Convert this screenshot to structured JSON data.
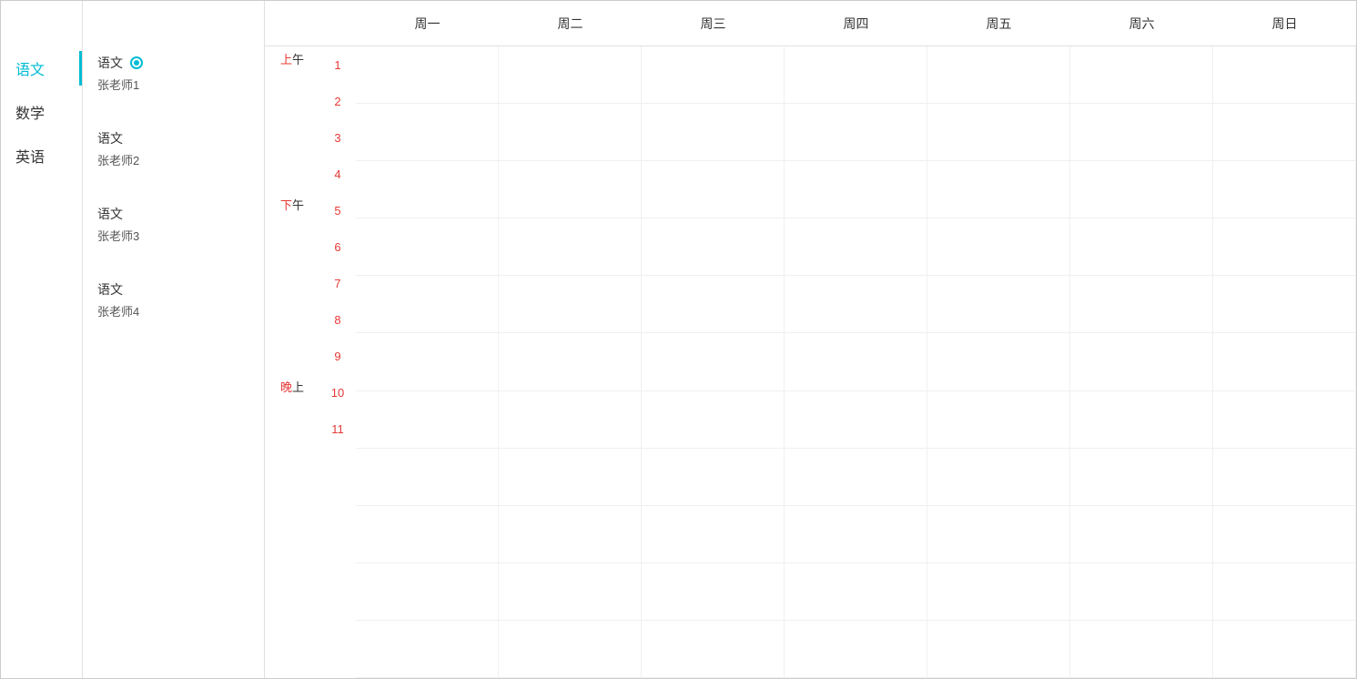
{
  "sidebar": {
    "items": [
      {
        "label": "语文",
        "active": true
      },
      {
        "label": "数学",
        "active": false
      },
      {
        "label": "英语",
        "active": false
      }
    ]
  },
  "teachers": [
    {
      "subject": "语文",
      "name": "张老师1",
      "selected": true
    },
    {
      "subject": "语文",
      "name": "张老师2",
      "selected": false
    },
    {
      "subject": "语文",
      "name": "张老师3",
      "selected": false
    },
    {
      "subject": "语文",
      "name": "张老师4",
      "selected": false
    }
  ],
  "days": [
    "周一",
    "周二",
    "周三",
    "周四",
    "周五",
    "周六",
    "周日"
  ],
  "time_sections": [
    {
      "label": "上午",
      "color": "red",
      "periods": [
        1,
        2,
        3,
        4
      ]
    },
    {
      "label": "下午",
      "color": "red",
      "periods": [
        5,
        6,
        7,
        8,
        9
      ]
    },
    {
      "label": "晚上",
      "color": "red",
      "periods": [
        10,
        11
      ]
    }
  ],
  "all_periods": [
    1,
    2,
    3,
    4,
    5,
    6,
    7,
    8,
    9,
    10,
    11
  ],
  "period_heights": {
    "1": 40,
    "2": 40,
    "3": 40,
    "4": 40,
    "5": 40,
    "6": 40,
    "7": 40,
    "8": 40,
    "9": 40,
    "10": 40,
    "11": 40
  }
}
